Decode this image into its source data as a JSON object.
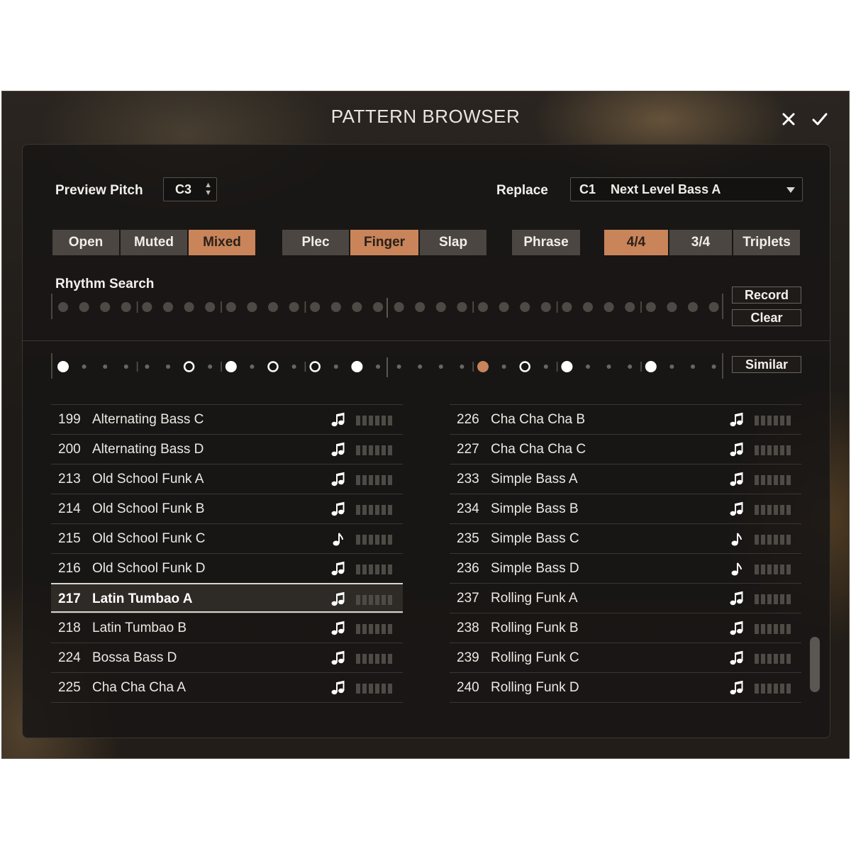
{
  "window": {
    "title": "PATTERN BROWSER"
  },
  "top": {
    "preview_pitch_label": "Preview Pitch",
    "preview_pitch_value": "C3",
    "replace_label": "Replace",
    "replace_note": "C1",
    "replace_name": "Next Level Bass A"
  },
  "filters": {
    "articulation": [
      {
        "label": "Open",
        "active": false
      },
      {
        "label": "Muted",
        "active": false
      },
      {
        "label": "Mixed",
        "active": true
      }
    ],
    "technique": [
      {
        "label": "Plec",
        "active": false
      },
      {
        "label": "Finger",
        "active": true
      },
      {
        "label": "Slap",
        "active": false
      }
    ],
    "phrase": [
      {
        "label": "Phrase",
        "active": false
      }
    ],
    "meter": [
      {
        "label": "4/4",
        "active": true
      },
      {
        "label": "3/4",
        "active": false
      },
      {
        "label": "Triplets",
        "active": false
      }
    ]
  },
  "rhythm_search": {
    "label": "Rhythm Search",
    "record_label": "Record",
    "clear_label": "Clear",
    "steps": 32
  },
  "pattern_row": {
    "similar_label": "Similar",
    "steps": [
      "filled",
      "dot",
      "dot",
      "dot",
      "dot",
      "dot",
      "hollow",
      "dot",
      "filled",
      "dot",
      "hollow",
      "dot",
      "hollow",
      "dot",
      "filled",
      "dot",
      "dot",
      "dot",
      "dot",
      "dot",
      "orange",
      "dot",
      "hollow",
      "dot",
      "filled",
      "dot",
      "dot",
      "dot",
      "filled",
      "dot",
      "dot",
      "dot"
    ]
  },
  "list_left": [
    {
      "num": "199",
      "name": "Alternating Bass C",
      "icon": "double-note-icon",
      "selected": false
    },
    {
      "num": "200",
      "name": "Alternating Bass D",
      "icon": "double-note-icon",
      "selected": false
    },
    {
      "num": "213",
      "name": "Old School Funk A",
      "icon": "double-note-icon",
      "selected": false
    },
    {
      "num": "214",
      "name": "Old School Funk B",
      "icon": "double-note-icon",
      "selected": false
    },
    {
      "num": "215",
      "name": "Old School Funk C",
      "icon": "single-note-icon",
      "selected": false
    },
    {
      "num": "216",
      "name": "Old School Funk D",
      "icon": "double-note-icon",
      "selected": false
    },
    {
      "num": "217",
      "name": "Latin Tumbao A",
      "icon": "double-note-icon",
      "selected": true
    },
    {
      "num": "218",
      "name": "Latin Tumbao B",
      "icon": "double-note-icon",
      "selected": false
    },
    {
      "num": "224",
      "name": "Bossa Bass D",
      "icon": "double-note-icon",
      "selected": false
    },
    {
      "num": "225",
      "name": "Cha Cha Cha A",
      "icon": "double-note-icon",
      "selected": false
    }
  ],
  "list_right": [
    {
      "num": "226",
      "name": "Cha Cha Cha B",
      "icon": "double-note-icon",
      "selected": false
    },
    {
      "num": "227",
      "name": "Cha Cha Cha C",
      "icon": "double-note-icon",
      "selected": false
    },
    {
      "num": "233",
      "name": "Simple Bass A",
      "icon": "double-note-icon",
      "selected": false
    },
    {
      "num": "234",
      "name": "Simple Bass B",
      "icon": "double-note-icon",
      "selected": false
    },
    {
      "num": "235",
      "name": "Simple Bass C",
      "icon": "single-note-icon",
      "selected": false
    },
    {
      "num": "236",
      "name": "Simple Bass D",
      "icon": "single-note-icon",
      "selected": false
    },
    {
      "num": "237",
      "name": "Rolling Funk A",
      "icon": "double-note-icon",
      "selected": false
    },
    {
      "num": "238",
      "name": "Rolling Funk B",
      "icon": "double-note-icon",
      "selected": false
    },
    {
      "num": "239",
      "name": "Rolling Funk C",
      "icon": "double-note-icon",
      "selected": false
    },
    {
      "num": "240",
      "name": "Rolling Funk D",
      "icon": "double-note-icon",
      "selected": false
    }
  ],
  "colors": {
    "accent": "#c9845a",
    "button": "#4b4641",
    "panel": "#181614"
  }
}
